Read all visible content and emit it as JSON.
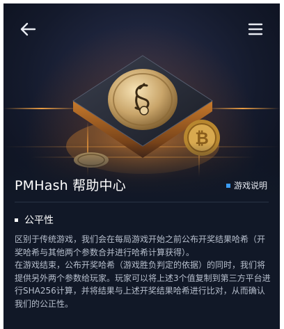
{
  "header": {
    "back_icon": "arrow-left-icon",
    "menu_icon": "hamburger-menu-icon"
  },
  "hero": {
    "coin_icons": [
      "horse-logo-icon",
      "bitcoin-coin-icon"
    ]
  },
  "page": {
    "title": "PMHash 帮助中心",
    "tag_label": "游戏说明"
  },
  "section": {
    "title": "公平性",
    "paragraphs": [
      "区别于传统游戏，我们会在每局游戏开始之前公布开奖结果哈希（开奖哈希与其他两个参数合并进行哈希计算获得）。",
      "在游戏结束，公布开奖哈希（游戏胜负判定的依据）的同时，我们将提供另外两个参数给玩家。玩家可以将上述3个值复制到第三方平台进行SHA256计算，并将结果与上述开奖结果哈希进行比对，从而确认我们的公正性。"
    ]
  },
  "colors": {
    "background": "#111827",
    "accent": "#3b9cf5",
    "glow": "#e0892f"
  }
}
